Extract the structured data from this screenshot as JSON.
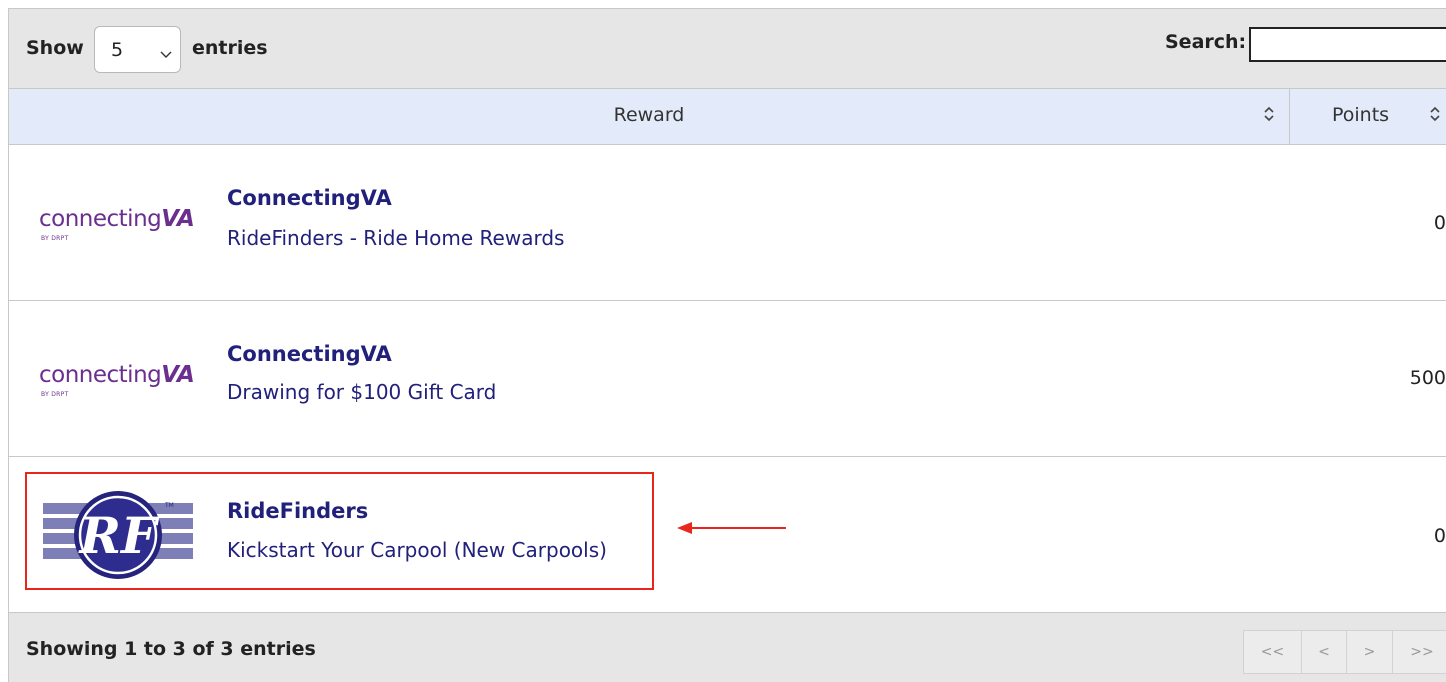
{
  "length_menu": {
    "show_label": "Show",
    "selected_value": "5",
    "entries_label": "entries"
  },
  "search": {
    "label": "Search:",
    "value": ""
  },
  "table": {
    "columns": [
      "Reward",
      "Points"
    ],
    "rows": [
      {
        "logo": "connectingVA-logo",
        "logo_text": "connecting",
        "logo_text_bold": "VA",
        "logo_sub": "BY DRPT",
        "title": "ConnectingVA",
        "description": "RideFinders - Ride Home Rewards",
        "points": "0"
      },
      {
        "logo": "connectingVA-logo",
        "logo_text": "connecting",
        "logo_text_bold": "VA",
        "logo_sub": "BY DRPT",
        "title": "ConnectingVA",
        "description": "Drawing for $100 Gift Card",
        "points": "500"
      },
      {
        "logo": "ridefinders-logo",
        "title": "RideFinders",
        "description": "Kickstart Your Carpool (New Carpools)",
        "points": "0"
      }
    ]
  },
  "footer": {
    "info": "Showing 1 to 3 of 3 entries",
    "pager": [
      "<<",
      "<",
      ">",
      ">>"
    ]
  },
  "colors": {
    "header_bg": "#e3ebfb",
    "toolbar_bg": "#e6e6e6",
    "link_text": "#21207a",
    "logo_purple": "#6a2f8f",
    "highlight": "#e8261b"
  }
}
